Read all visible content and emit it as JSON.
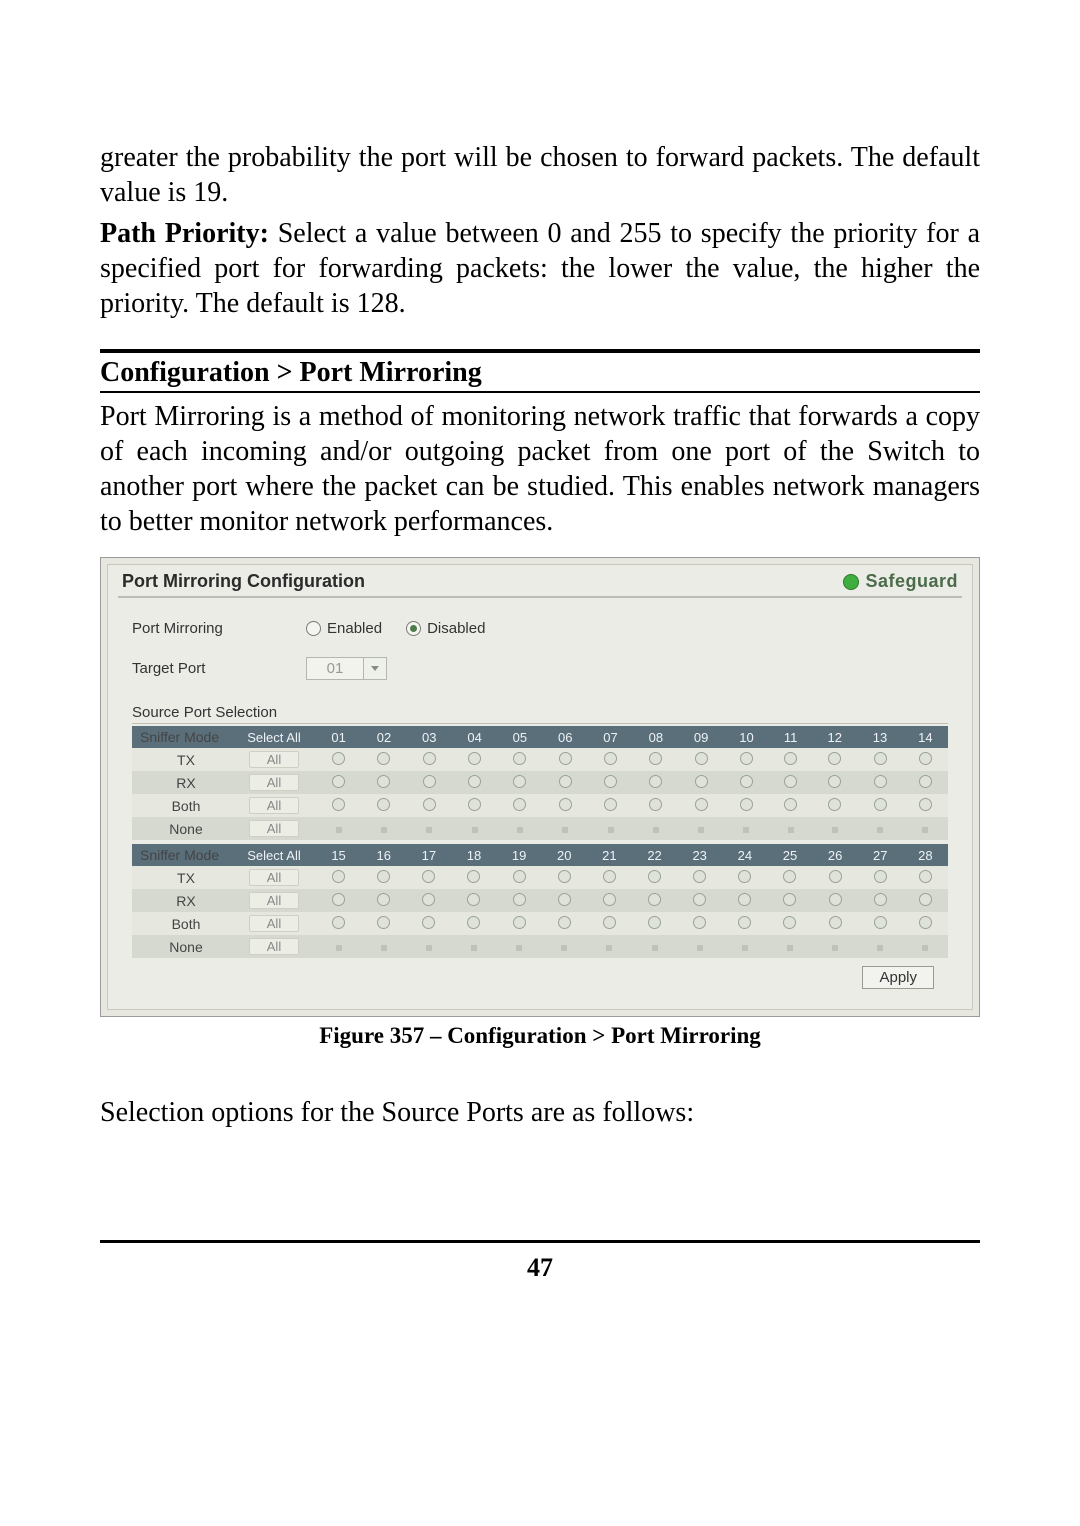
{
  "text": {
    "p1": "greater the probability the port will be chosen to forward packets. The default value is 19.",
    "p2a": "Path Priority:",
    "p2b": " Select a value between 0 and 255 to specify the priority for a specified port for forwarding packets: the lower the value, the higher the priority. The default is 128.",
    "section_title": "Configuration > Port Mirroring",
    "p3": "Port Mirroring is a method of monitoring network traffic that forwards a copy of each incoming and/or outgoing packet from one port of the Switch to another port where the packet can be studied. This enables network managers to better monitor network performances.",
    "fig_caption": "Figure 357 – Configuration > Port Mirroring",
    "p4": "Selection options for the Source Ports are as follows:",
    "page_num": "47"
  },
  "shot": {
    "title": "Port Mirroring Configuration",
    "safeguard": "Safeguard",
    "form": {
      "mirroring_label": "Port Mirroring",
      "enabled_label": "Enabled",
      "disabled_label": "Disabled",
      "mirroring_value": "Disabled",
      "target_label": "Target Port",
      "target_value": "01",
      "src_label": "Source Port Selection",
      "apply_label": "Apply"
    },
    "grid": {
      "mode_header": "Sniffer Mode",
      "select_all_header": "Select All",
      "all_button": "All",
      "rows": [
        "TX",
        "RX",
        "Both",
        "None"
      ],
      "ports_a": [
        "01",
        "02",
        "03",
        "04",
        "05",
        "06",
        "07",
        "08",
        "09",
        "10",
        "11",
        "12",
        "13",
        "14"
      ],
      "ports_b": [
        "15",
        "16",
        "17",
        "18",
        "19",
        "20",
        "21",
        "22",
        "23",
        "24",
        "25",
        "26",
        "27",
        "28"
      ]
    }
  }
}
